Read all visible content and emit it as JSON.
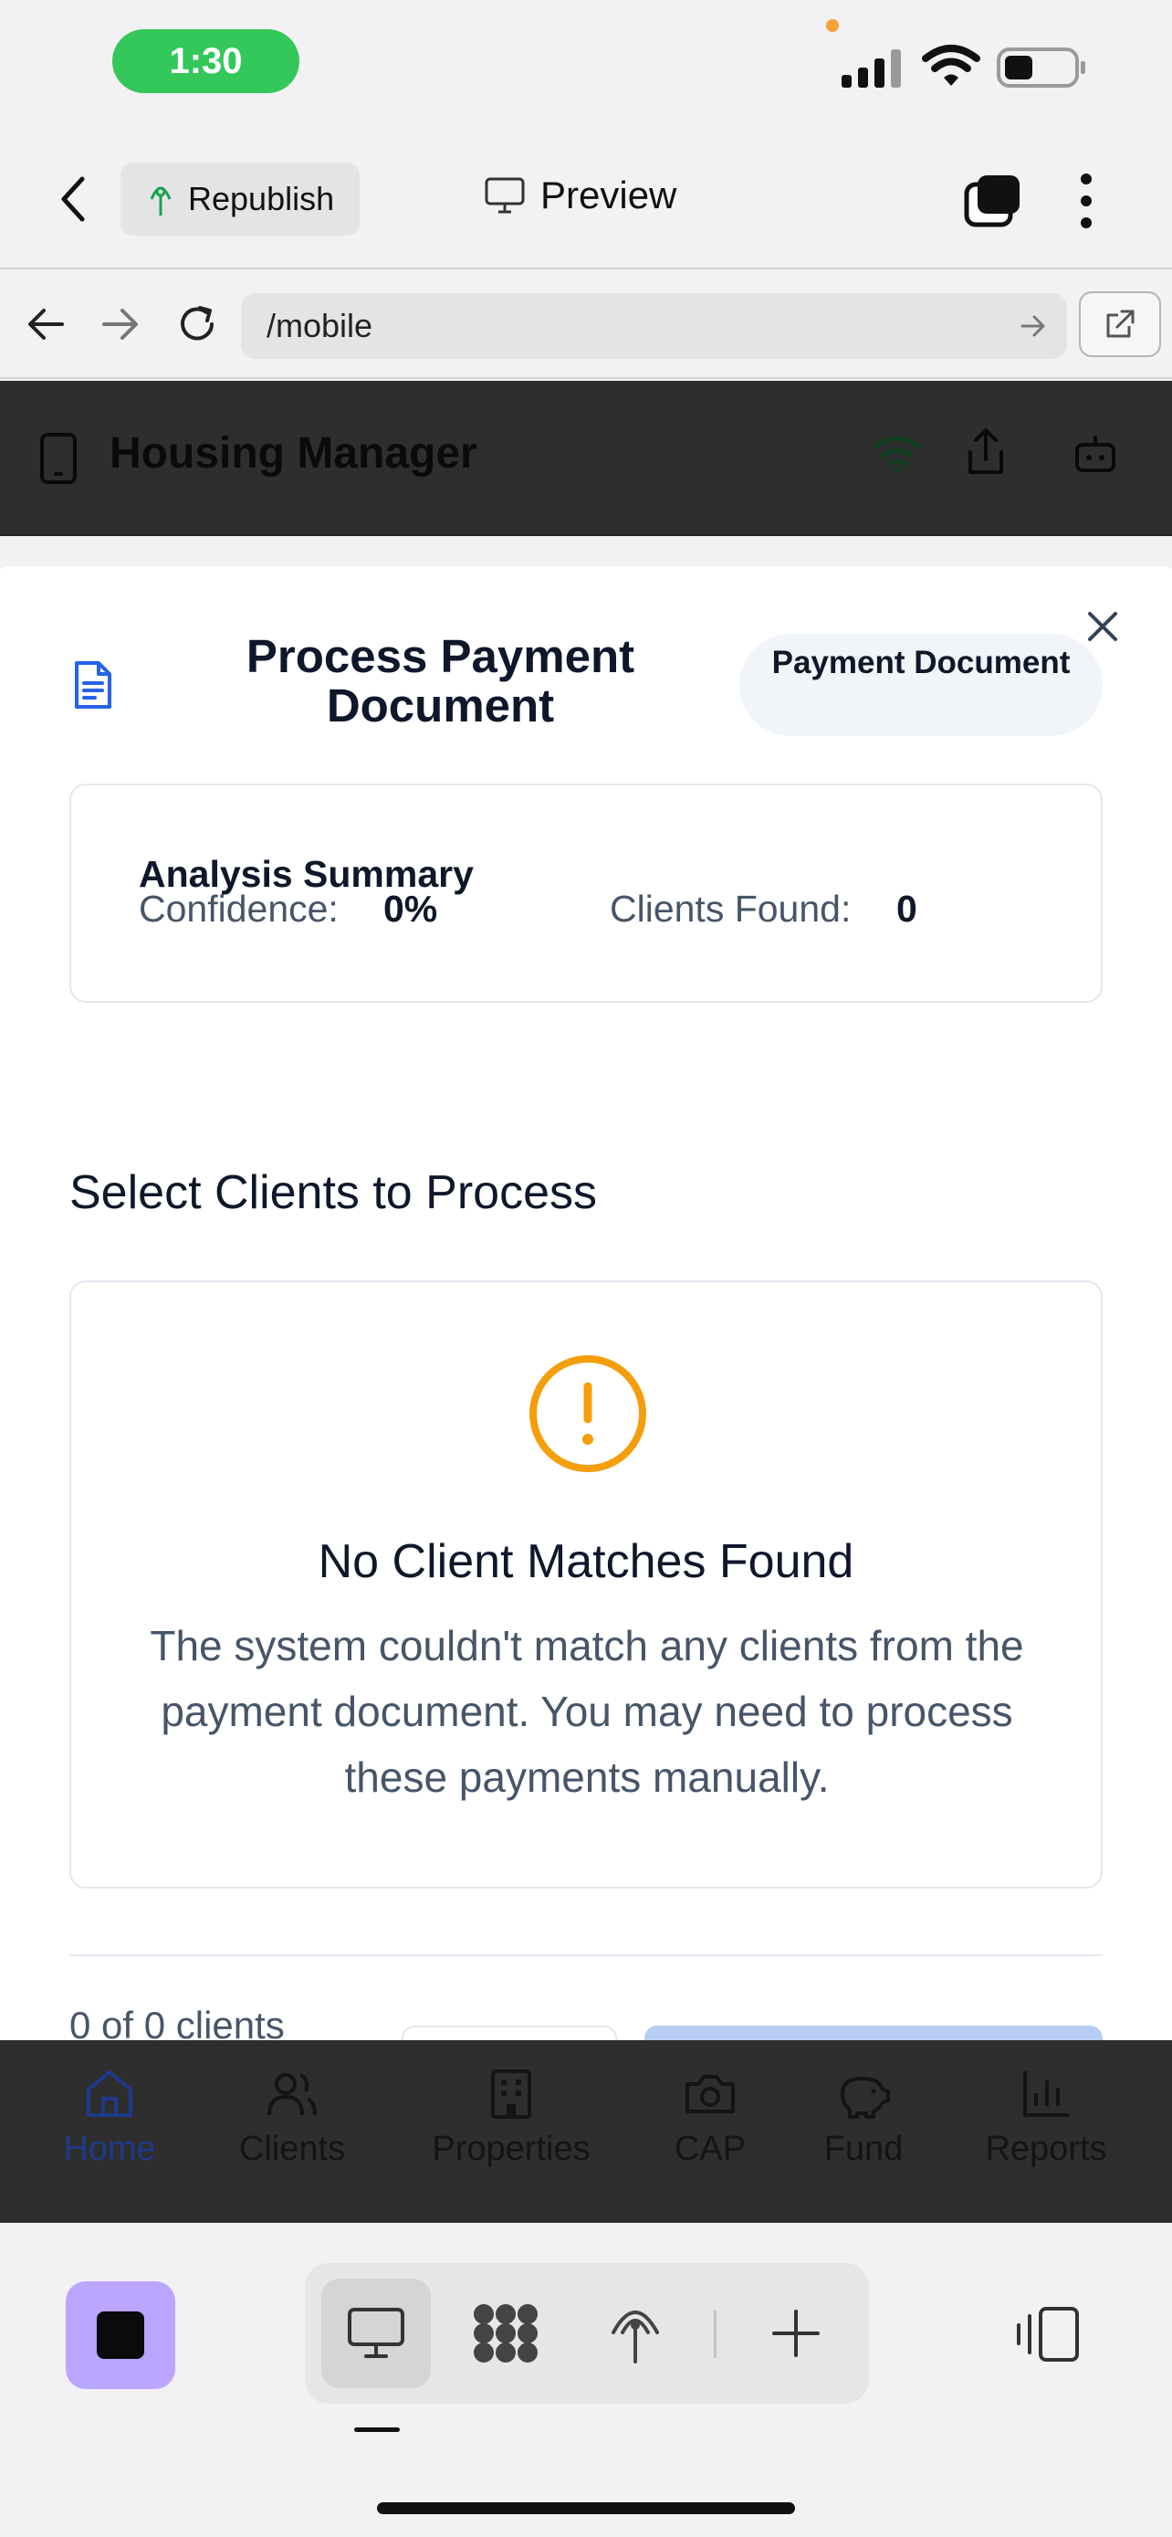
{
  "status_bar": {
    "time": "1:30"
  },
  "toolbar": {
    "republish_label": "Republish",
    "preview_label": "Preview"
  },
  "browser": {
    "url": "/mobile"
  },
  "app_header": {
    "title": "Housing Manager"
  },
  "modal": {
    "title": "Process Payment Document",
    "badge": "Payment Document",
    "summary": {
      "title": "Analysis Summary",
      "confidence_label": "Confidence:",
      "confidence_value": "0%",
      "clients_found_label": "Clients Found:",
      "clients_found_value": "0"
    },
    "section_title": "Select Clients to Process",
    "empty_state": {
      "title": "No Client Matches Found",
      "description": "The system couldn't match any clients from the payment document. You may need to process these payments manually."
    },
    "footer": {
      "count_text": "0 of 0 clients"
    }
  },
  "bottom_nav": {
    "items": [
      {
        "label": "Home",
        "icon": "home-icon",
        "active": true
      },
      {
        "label": "Clients",
        "icon": "users-icon",
        "active": false
      },
      {
        "label": "Properties",
        "icon": "building-icon",
        "active": false
      },
      {
        "label": "CAP",
        "icon": "camera-icon",
        "active": false
      },
      {
        "label": "Fund",
        "icon": "piggy-bank-icon",
        "active": false
      },
      {
        "label": "Reports",
        "icon": "bar-chart-icon",
        "active": false
      }
    ]
  },
  "colors": {
    "accent_green": "#34c759",
    "brand_blue": "#2563eb",
    "warning": "#f59e0b",
    "stop_button": "#b9a6ff"
  }
}
